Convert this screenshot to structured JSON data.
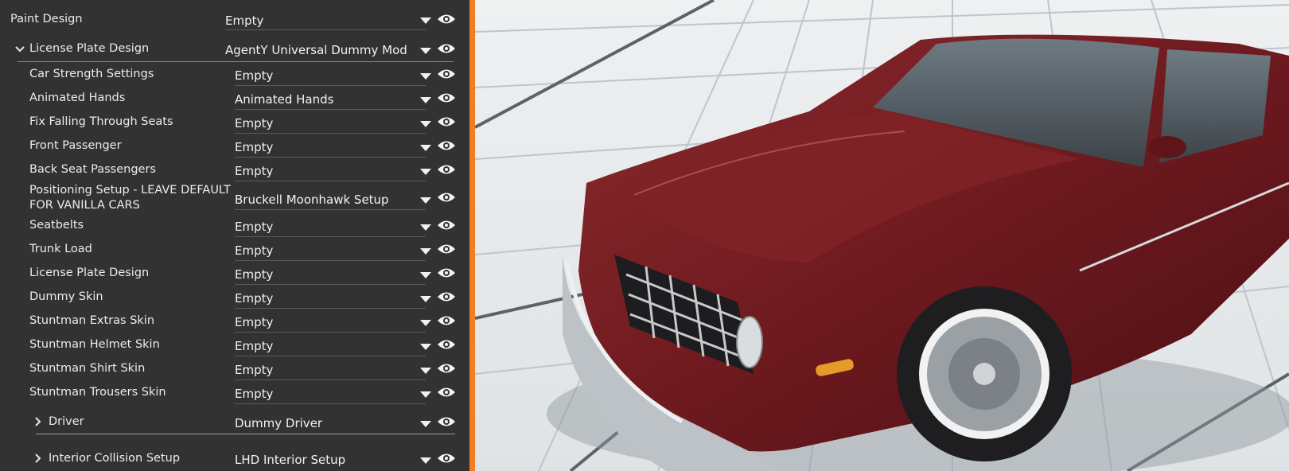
{
  "panel": {
    "rows": [
      {
        "label": "Paint Design",
        "value": "Empty"
      },
      {
        "label": "License Plate Design",
        "value": "AgentY Universal Dummy Mod"
      },
      {
        "label": "Car Strength Settings",
        "value": "Empty"
      },
      {
        "label": "Animated Hands",
        "value": "Animated Hands"
      },
      {
        "label": "Fix Falling Through Seats",
        "value": "Empty"
      },
      {
        "label": "Front Passenger",
        "value": "Empty"
      },
      {
        "label": "Back Seat Passengers",
        "value": "Empty"
      },
      {
        "label": "Positioning Setup - LEAVE DEFAULT",
        "label2": "FOR VANILLA CARS",
        "value": "Bruckell Moonhawk Setup"
      },
      {
        "label": "Seatbelts",
        "value": "Empty"
      },
      {
        "label": "Trunk Load",
        "value": "Empty"
      },
      {
        "label": "License Plate Design",
        "value": "Empty"
      },
      {
        "label": "Dummy Skin",
        "value": "Empty"
      },
      {
        "label": "Stuntman Extras Skin",
        "value": "Empty"
      },
      {
        "label": "Stuntman Helmet Skin",
        "value": "Empty"
      },
      {
        "label": "Stuntman Shirt Skin",
        "value": "Empty"
      },
      {
        "label": "Stuntman Trousers Skin",
        "value": "Empty"
      },
      {
        "label": "Driver",
        "value": "Dummy Driver"
      },
      {
        "label": "Interior Collision Setup",
        "value": "LHD Interior Setup"
      }
    ]
  },
  "colors": {
    "accent_divider": "#f47d1f",
    "panel_bg": "#323232",
    "car_paint": "#7a1f22"
  },
  "icons": {
    "visibility": "eye-icon",
    "dropdown": "caret-down-icon",
    "expanded": "chevron-down-icon",
    "collapsed": "chevron-right-icon"
  }
}
